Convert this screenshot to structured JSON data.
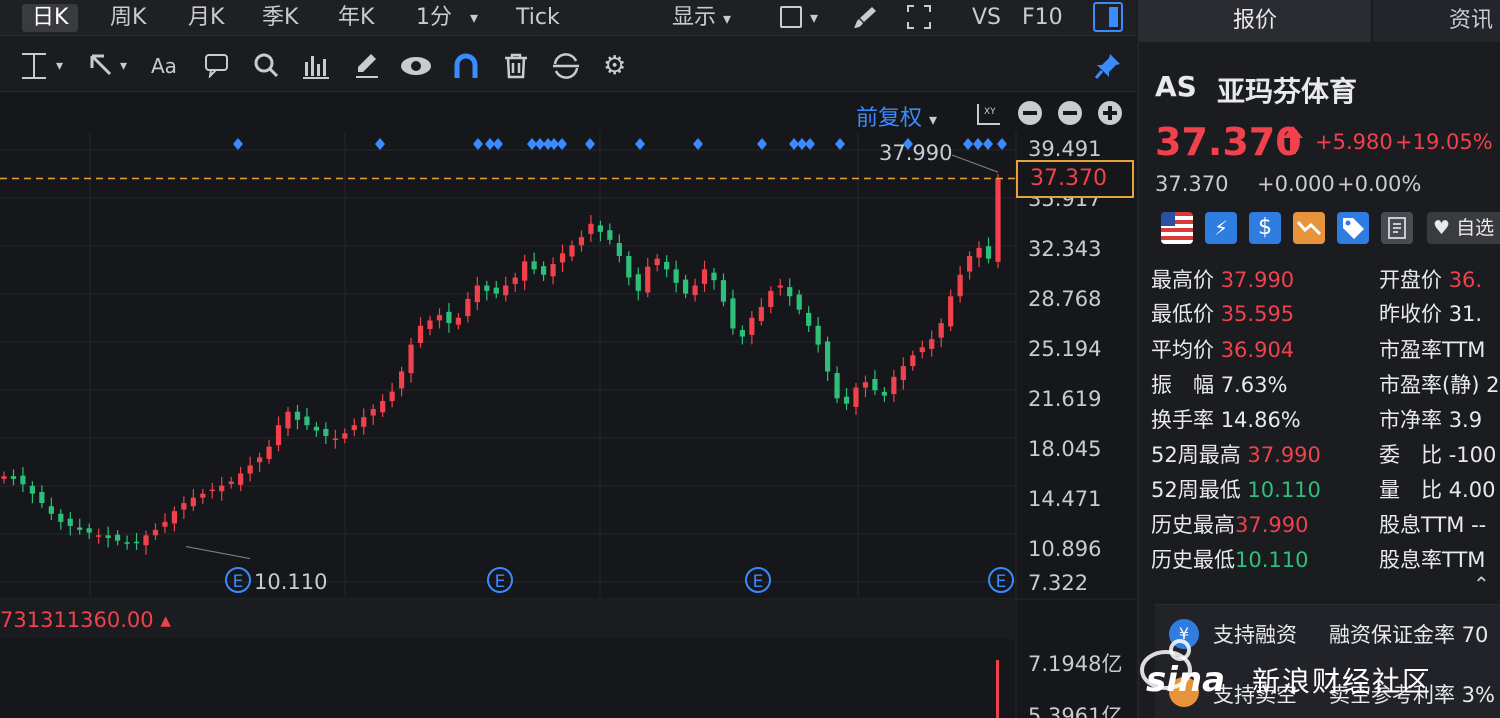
{
  "top_tabs": [
    "日K",
    "周K",
    "月K",
    "季K",
    "年K",
    "1分",
    "Tick"
  ],
  "toolbar_right": {
    "display": "显示",
    "vs": "VS",
    "f10": "F10"
  },
  "chart": {
    "adjust": "前复权",
    "y_labels": [
      "39.491",
      "35.917",
      "32.343",
      "28.768",
      "25.194",
      "21.619",
      "18.045",
      "14.471",
      "10.896",
      "7.322"
    ],
    "current_price_tag": "37.370",
    "high_marker": "37.990",
    "low_marker": "10.110",
    "volume_value": "731311360.00",
    "volume_axis": [
      "7.1948亿",
      "5.3961亿"
    ]
  },
  "chart_data": {
    "type": "candlestick",
    "ylim": [
      7.322,
      39.491
    ],
    "y_ticks": [
      39.491,
      35.917,
      32.343,
      28.768,
      25.194,
      21.619,
      18.045,
      14.471,
      10.896,
      7.322
    ],
    "current_price": 37.37,
    "period_high": 37.99,
    "period_low": 10.11,
    "series_close_approx": [
      15.2,
      15.0,
      14.6,
      13.9,
      13.2,
      12.4,
      11.8,
      11.5,
      11.2,
      11.0,
      10.8,
      10.6,
      10.4,
      10.2,
      10.3,
      10.8,
      11.2,
      11.8,
      12.6,
      13.2,
      13.6,
      13.9,
      14.2,
      14.5,
      14.8,
      15.4,
      16.0,
      16.6,
      17.4,
      19.0,
      20.0,
      19.4,
      19.0,
      18.6,
      18.2,
      18.0,
      18.4,
      19.0,
      19.6,
      20.2,
      20.8,
      21.5,
      23.0,
      25.0,
      26.4,
      26.8,
      27.2,
      26.6,
      27.0,
      28.4,
      29.4,
      29.0,
      28.8,
      29.4,
      30.0,
      31.2,
      30.6,
      30.2,
      31.0,
      31.8,
      32.4,
      33.0,
      34.0,
      33.4,
      32.8,
      31.6,
      30.0,
      29.0,
      30.8,
      31.4,
      30.6,
      29.6,
      28.8,
      29.4,
      30.6,
      29.8,
      28.2,
      26.2,
      25.6,
      27.0,
      27.8,
      29.0,
      29.4,
      28.6,
      27.6,
      26.4,
      25.0,
      23.0,
      21.0,
      20.6,
      21.8,
      22.2,
      21.6,
      21.2,
      22.6,
      23.4,
      24.2,
      24.8,
      25.4,
      26.6,
      28.6,
      30.2,
      31.6,
      32.2,
      31.4,
      37.37
    ],
    "event_markers": [
      "E",
      "E",
      "E",
      "E"
    ]
  },
  "quote": {
    "symbol": "AS",
    "name": "亚玛芬体育",
    "price": "37.370",
    "change": "+5.980",
    "change_pct": "+19.05%",
    "ext_price": "37.370",
    "ext_change": "+0.000",
    "ext_pct": "+0.00%",
    "watchlist": "自选"
  },
  "right_tabs": [
    "报价",
    "资讯"
  ],
  "stats_left": [
    {
      "label": "最高价",
      "value": "37.990",
      "color": "red"
    },
    {
      "label": "最低价",
      "value": "35.595",
      "color": "red"
    },
    {
      "label": "平均价",
      "value": "36.904",
      "color": "red"
    },
    {
      "label": "振　幅",
      "value": "7.63%",
      "color": "white"
    },
    {
      "label": "换手率",
      "value": "14.86%",
      "color": "white"
    },
    {
      "label": "52周最高",
      "value": "37.990",
      "color": "red"
    },
    {
      "label": "52周最低",
      "value": "10.110",
      "color": "green"
    },
    {
      "label": "历史最高",
      "value": "37.990",
      "color": "red"
    },
    {
      "label": "历史最低",
      "value": "10.110",
      "color": "green"
    }
  ],
  "stats_right": [
    {
      "label": "开盘价",
      "value": "36.",
      "color": "red"
    },
    {
      "label": "昨收价",
      "value": "31.",
      "color": "white"
    },
    {
      "label": "市盈率TTM",
      "value": "",
      "color": "white"
    },
    {
      "label": "市盈率(静)",
      "value": "2",
      "color": "white"
    },
    {
      "label": "市净率",
      "value": "3.9",
      "color": "white"
    },
    {
      "label": "委　比",
      "value": "-100",
      "color": "white"
    },
    {
      "label": "量　比",
      "value": "4.00",
      "color": "white"
    },
    {
      "label": "股息TTM",
      "value": "--",
      "color": "white"
    },
    {
      "label": "股息率TTM",
      "value": "",
      "color": "white"
    }
  ],
  "services": [
    {
      "label": "支持融资",
      "extra": "融资保证金率 70"
    },
    {
      "label": "支持卖空",
      "extra": "卖空参考利率 3%"
    }
  ],
  "watermark": {
    "text": "新浪财经社区",
    "brand": "sina"
  }
}
